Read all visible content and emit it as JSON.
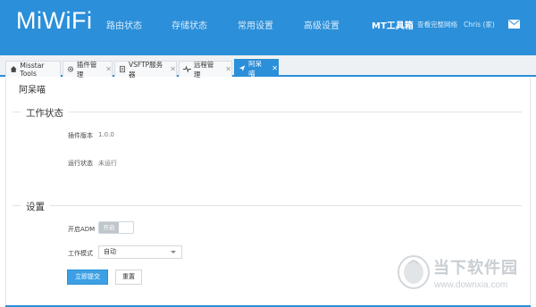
{
  "header": {
    "logo": "MiWiFi",
    "nav": [
      "路由状态",
      "存储状态",
      "常用设置",
      "高级设置",
      "MT工具箱"
    ],
    "links": [
      "查看完整网络",
      "Chris (家)"
    ]
  },
  "tabs": [
    {
      "label": "Misstar Tools",
      "icon": "home-icon",
      "closable": false
    },
    {
      "label": "插件管理",
      "icon": "gear-icon",
      "closable": true
    },
    {
      "label": "VSFTP服务器",
      "icon": "doc-icon",
      "closable": true
    },
    {
      "label": "远程管理",
      "icon": "pulse-icon",
      "closable": true
    },
    {
      "label": "阿呆喵",
      "icon": "plane-icon",
      "closable": true,
      "active": true
    }
  ],
  "page": {
    "title": "阿呆喵",
    "status_section": "工作状态",
    "plugin_version_label": "插件版本",
    "plugin_version": "1.0.0",
    "run_status_label": "运行状态",
    "run_status": "未运行",
    "settings_section": "设置",
    "adm_label": "开启ADM",
    "adm_toggle": "开启",
    "mode_label": "工作模式",
    "mode_value": "自动",
    "submit": "立即提交",
    "reset": "重置"
  },
  "watermark": {
    "name": "当下软件园",
    "url": "www.downxia.com"
  },
  "colors": {
    "header_bg": "#2b8fd9",
    "primary_button": "#3ea0e4"
  }
}
